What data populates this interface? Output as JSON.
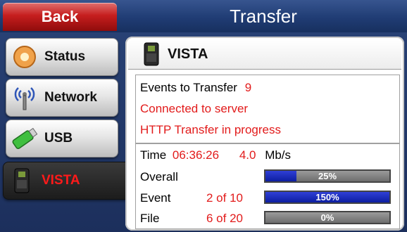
{
  "header": {
    "back_label": "Back",
    "title": "Transfer"
  },
  "sidebar": {
    "items": [
      {
        "label": "Status",
        "icon": "status-icon"
      },
      {
        "label": "Network",
        "icon": "antenna-icon"
      },
      {
        "label": "USB",
        "icon": "usb-drive-icon"
      },
      {
        "label": "VISTA",
        "icon": "vista-device-icon",
        "active": true
      }
    ]
  },
  "panel": {
    "title": "VISTA",
    "events_label": "Events to Transfer",
    "events_value": "9",
    "connection_status": "Connected to server",
    "transfer_status": "HTTP Transfer in progress",
    "time_label": "Time",
    "time_value": "06:36:26",
    "rate_value": "4.0",
    "rate_unit": "Mb/s",
    "progress": [
      {
        "label": "Overall",
        "count": "",
        "percent_text": "25%",
        "fill_fraction": 0.25
      },
      {
        "label": "Event",
        "count": "2 of 10",
        "percent_text": "150%",
        "fill_fraction": 1.0
      },
      {
        "label": "File",
        "count": "6 of 20",
        "percent_text": "0%",
        "fill_fraction": 0.0
      }
    ]
  },
  "colors": {
    "accent_red": "#e21b1b",
    "progress_blue": "#1a2cc0",
    "back_red": "#c61e1e"
  }
}
